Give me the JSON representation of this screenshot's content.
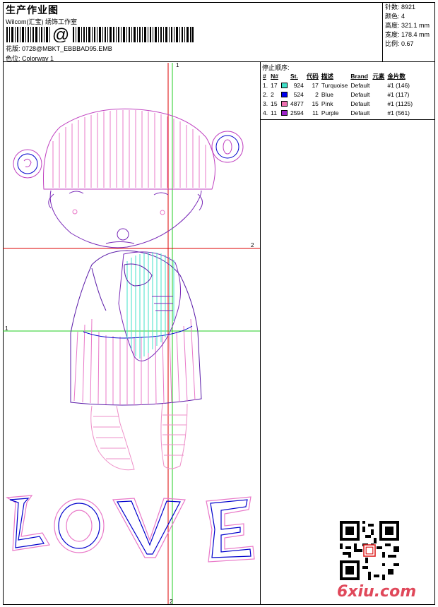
{
  "header": {
    "title": "生产作业图",
    "company": "Wilcom(汇宝) 绣饰工作室",
    "barcode_text": "@",
    "design_label": "花版: 0728@MBKT_EBBBAD95.EMB",
    "colorway_label": "色位: Colorway 1"
  },
  "stats": {
    "stitches": "针数: 8921",
    "colors": "颜色: 4",
    "height": "高度: 321.1 mm",
    "width": "宽度: 178.4 mm",
    "scale": "比例: 0.67"
  },
  "stop_sequence": {
    "title": "停止顺序:",
    "headers": [
      "#",
      "N#",
      "St.",
      "代码",
      "描述",
      "Brand",
      "元素",
      "金片数"
    ],
    "rows": [
      {
        "seq": "1.",
        "n": "17",
        "color": "#40e0c8",
        "st": "924",
        "code": "17",
        "desc": "Turquoise",
        "brand": "Default",
        "elem": "",
        "seq_count": "#1 (146)"
      },
      {
        "seq": "2.",
        "n": "2",
        "color": "#0000ee",
        "st": "524",
        "code": "2",
        "desc": "Blue",
        "brand": "Default",
        "elem": "",
        "seq_count": "#1 (117)"
      },
      {
        "seq": "3.",
        "n": "15",
        "color": "#ee6fb0",
        "st": "4877",
        "code": "15",
        "desc": "Pink",
        "brand": "Default",
        "elem": "",
        "seq_count": "#1 (1125)"
      },
      {
        "seq": "4.",
        "n": "11",
        "color": "#9b22c8",
        "st": "2594",
        "code": "11",
        "desc": "Purple",
        "brand": "Default",
        "elem": "",
        "seq_count": "#1 (561)"
      }
    ]
  },
  "guides": {
    "v_green_top": "1",
    "h_red_right": "2",
    "h_green_left": "1",
    "v_red_bottom": "2"
  },
  "design": {
    "word": "LOVE"
  },
  "watermark": {
    "logo": "6xiu.com"
  }
}
